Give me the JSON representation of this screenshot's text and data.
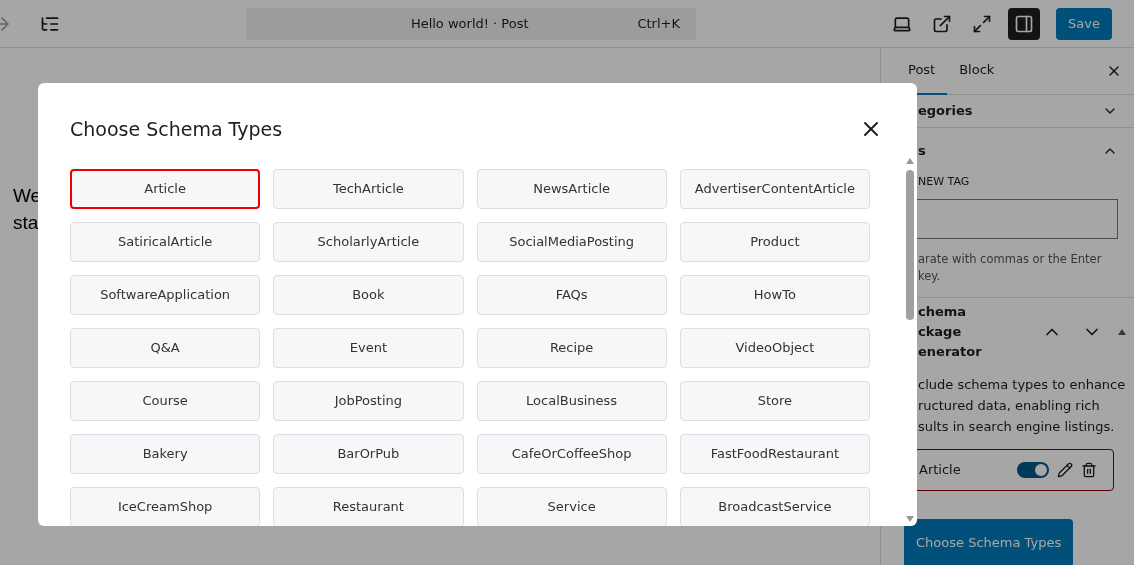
{
  "topbar": {
    "document_title": "Hello world! · Post",
    "shortcut": "Ctrl+K",
    "save": "Save",
    "sidebar_toggle_on": true
  },
  "editor": {
    "paragraph_lines": [
      "We",
      "sta"
    ]
  },
  "sidebar": {
    "tabs": [
      {
        "label": "Post",
        "selected": true
      },
      {
        "label": "Block",
        "selected": false
      }
    ],
    "categories": {
      "label": "egories",
      "expanded": false
    },
    "tags": {
      "label": "s",
      "expanded": true,
      "field_label": "NEW TAG",
      "help": "arate with commas or the Enter key."
    },
    "schema_panel": {
      "title_lines": [
        "chema",
        "ckage",
        "enerator"
      ],
      "description_lines": [
        "clude schema types to enhance",
        "ructured data, enabling rich",
        "sults in search engine listings."
      ],
      "items": [
        {
          "label": "Article",
          "on": true
        }
      ],
      "button": "Choose Schema Types"
    }
  },
  "modal": {
    "title": "Choose Schema Types",
    "types": [
      {
        "label": "Article",
        "selected": true
      },
      {
        "label": "TechArticle",
        "selected": false
      },
      {
        "label": "NewsArticle",
        "selected": false
      },
      {
        "label": "AdvertiserContentArticle",
        "selected": false
      },
      {
        "label": "SatiricalArticle",
        "selected": false
      },
      {
        "label": "ScholarlyArticle",
        "selected": false
      },
      {
        "label": "SocialMediaPosting",
        "selected": false
      },
      {
        "label": "Product",
        "selected": false
      },
      {
        "label": "SoftwareApplication",
        "selected": false
      },
      {
        "label": "Book",
        "selected": false
      },
      {
        "label": "FAQs",
        "selected": false
      },
      {
        "label": "HowTo",
        "selected": false
      },
      {
        "label": "Q&A",
        "selected": false
      },
      {
        "label": "Event",
        "selected": false
      },
      {
        "label": "Recipe",
        "selected": false
      },
      {
        "label": "VideoObject",
        "selected": false
      },
      {
        "label": "Course",
        "selected": false
      },
      {
        "label": "JobPosting",
        "selected": false
      },
      {
        "label": "LocalBusiness",
        "selected": false
      },
      {
        "label": "Store",
        "selected": false
      },
      {
        "label": "Bakery",
        "selected": false
      },
      {
        "label": "BarOrPub",
        "selected": false
      },
      {
        "label": "CafeOrCoffeeShop",
        "selected": false
      },
      {
        "label": "FastFoodRestaurant",
        "selected": false
      },
      {
        "label": "IceCreamShop",
        "selected": false
      },
      {
        "label": "Restaurant",
        "selected": false
      },
      {
        "label": "Service",
        "selected": false
      },
      {
        "label": "BroadcastService",
        "selected": false
      }
    ]
  }
}
